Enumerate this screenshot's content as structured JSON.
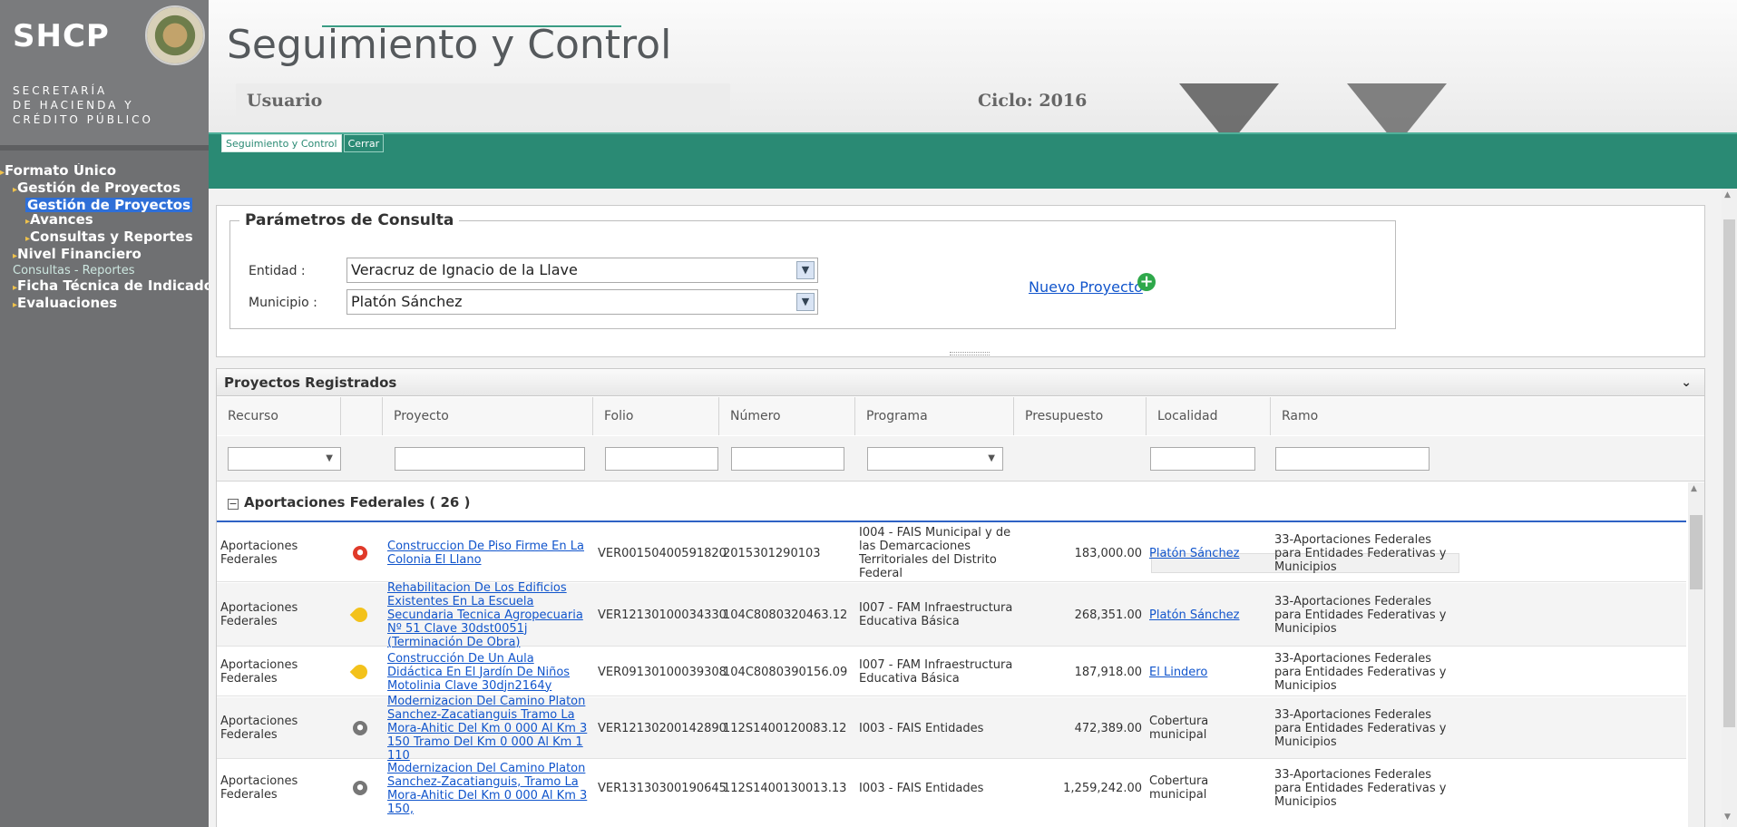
{
  "brand": {
    "logo_text": "SHCP",
    "sub_lines": [
      "SECRETARÍA",
      "DE HACIENDA Y",
      "CRÉDITO PÚBLICO"
    ]
  },
  "header": {
    "title": "Seguimiento y Control",
    "user_label": "Usuario",
    "cycle_label": "Ciclo: 2016",
    "toolbar_icons": [
      "print-icon",
      "phone-icon",
      "mail-icon",
      "home-icon",
      "close-icon",
      "clipboard-icon",
      "hand-pointer-icon",
      "minus-icon",
      "back-icon",
      "help-icon"
    ]
  },
  "tabs": [
    {
      "label": "Seguimiento y Control"
    },
    {
      "label": "Cerrar"
    }
  ],
  "sidebar": {
    "items": [
      {
        "label": "Formato Único"
      },
      {
        "label": "Gestión de Proyectos"
      },
      {
        "label": "Gestión de Proyectos"
      },
      {
        "label": "Avances"
      },
      {
        "label": "Consultas y Reportes"
      },
      {
        "label": "Nivel Financiero"
      },
      {
        "label": "Consultas - Reportes"
      },
      {
        "label": "Ficha Técnica de Indicadores"
      },
      {
        "label": "Evaluaciones"
      }
    ]
  },
  "params": {
    "legend": "Parámetros de Consulta",
    "entidad_label": "Entidad :",
    "entidad_value": "Veracruz de Ignacio de la Llave",
    "municipio_label": "Municipio :",
    "municipio_value": "Platón Sánchez",
    "new_project": "Nuevo Proyecto"
  },
  "projects": {
    "title": "Proyectos Registrados",
    "columns": [
      "Recurso",
      "",
      "Proyecto",
      "Folio",
      "Número",
      "Programa",
      "Presupuesto",
      "Localidad",
      "Ramo"
    ],
    "group_label": "Aportaciones Federales ( 26 )",
    "rows": [
      {
        "recurso": "Aportaciones Federales",
        "marker": "red",
        "proyecto": "Construccion De Piso Firme En La Colonia El Llano",
        "folio": "VER00150400591820",
        "numero": "2015301290103",
        "programa": "I004 - FAIS Municipal y de las Demarcaciones Territoriales del Distrito Federal",
        "presupuesto": "183,000.00",
        "localidad": "Platón Sánchez",
        "localidad_link": true,
        "ramo": "33-Aportaciones Federales para Entidades Federativas y Municipios"
      },
      {
        "recurso": "Aportaciones Federales",
        "marker": "yellow",
        "proyecto": "Rehabilitacion De Los Edificios Existentes En La Escuela Secundaria Tecnica Agropecuaria Nº 51 Clave 30dst0051j (Terminación De Obra)",
        "folio": "VER12130100034330",
        "numero": "104C8080320463.12",
        "programa": "I007 - FAM Infraestructura Educativa Básica",
        "presupuesto": "268,351.00",
        "localidad": "Platón Sánchez",
        "localidad_link": true,
        "ramo": "33-Aportaciones Federales para Entidades Federativas y Municipios"
      },
      {
        "recurso": "Aportaciones Federales",
        "marker": "yellow",
        "proyecto": "Construcción De Un Aula Didáctica En El Jardín De Niños Motolinia Clave 30djn2164y",
        "folio": "VER09130100039308",
        "numero": "104C8080390156.09",
        "programa": "I007 - FAM Infraestructura Educativa Básica",
        "presupuesto": "187,918.00",
        "localidad": "El Lindero",
        "localidad_link": true,
        "ramo": "33-Aportaciones Federales para Entidades Federativas y Municipios"
      },
      {
        "recurso": "Aportaciones Federales",
        "marker": "gray",
        "proyecto": "Modernizacion Del Camino Platon Sanchez-Zacatianguis Tramo La Mora-Ahitic Del Km 0 000 Al Km 3 150 Tramo Del Km 0 000 Al Km 1 110",
        "folio": "VER12130200142890",
        "numero": "112S1400120083.12",
        "programa": "I003 - FAIS Entidades",
        "presupuesto": "472,389.00",
        "localidad": "Cobertura municipal",
        "localidad_link": false,
        "ramo": "33-Aportaciones Federales para Entidades Federativas y Municipios"
      },
      {
        "recurso": "Aportaciones Federales",
        "marker": "gray",
        "proyecto": "Modernizacion Del Camino Platon Sanchez-Zacatianguis, Tramo La Mora-Ahitic Del Km 0 000 Al Km 3 150,",
        "folio": "VER13130300190645",
        "numero": "112S1400130013.13",
        "programa": "I003 - FAIS Entidades",
        "presupuesto": "1,259,242.00",
        "localidad": "Cobertura municipal",
        "localidad_link": false,
        "ramo": "33-Aportaciones Federales para Entidades Federativas y Municipios"
      }
    ]
  },
  "colors": {
    "accent": "#2a8a74",
    "sidebar": "#6f7072",
    "link": "#1155cc",
    "selection": "#2e6fd8"
  }
}
